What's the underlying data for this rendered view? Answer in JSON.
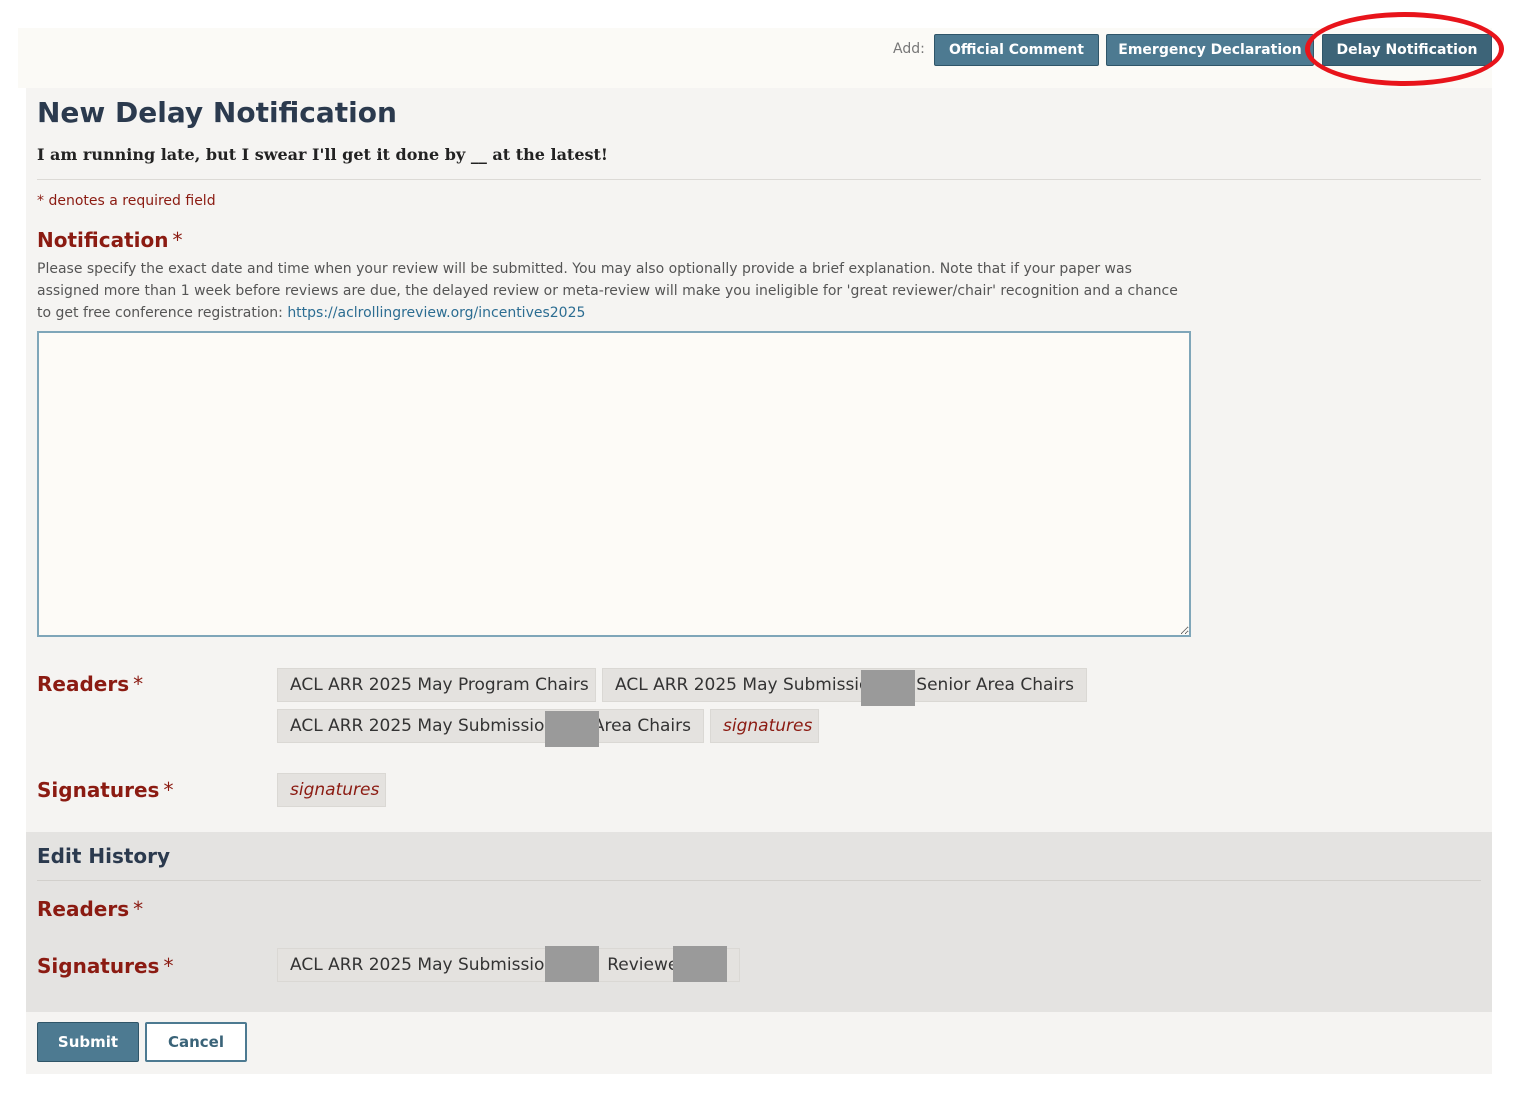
{
  "toolbar": {
    "add_label": "Add:",
    "buttons": [
      "Official Comment",
      "Emergency Declaration",
      "Delay Notification"
    ]
  },
  "form": {
    "title": "New Delay Notification",
    "subtitle": "I am running late, but I swear I'll get it done by __ at the latest!",
    "required_note": "* denotes a required field",
    "notification": {
      "label": "Notification",
      "required_mark": "*",
      "description": "Please specify the exact date and time when your review will be submitted. You may also optionally provide a brief explanation. Note that if your paper was assigned more than 1 week before reviews are due, the delayed review or meta-review will make you ineligible for 'great reviewer/chair' recognition and a chance to get free conference registration: ",
      "link_text": "https://aclrollingreview.org/incentives2025",
      "value": ""
    },
    "readers": {
      "label": "Readers",
      "required_mark": "*",
      "tags": [
        "ACL ARR 2025 May Program Chairs",
        "ACL ARR 2025 May Submissio",
        "Senior Area Chairs",
        "ACL ARR 2025 May Submission",
        "Area Chairs",
        "signatures"
      ]
    },
    "signatures": {
      "label": "Signatures",
      "required_mark": "*",
      "tags": [
        "signatures"
      ]
    }
  },
  "edit_history": {
    "title": "Edit History",
    "readers_label": "Readers",
    "signatures_label": "Signatures",
    "required_mark": "*",
    "signature_tag": [
      "ACL ARR 2025 May Submission",
      "Reviewer"
    ]
  },
  "actions": {
    "submit": "Submit",
    "cancel": "Cancel"
  },
  "colors": {
    "accent": "#4d7a91",
    "required": "#8b1b12",
    "highlight": "#e8141b"
  }
}
